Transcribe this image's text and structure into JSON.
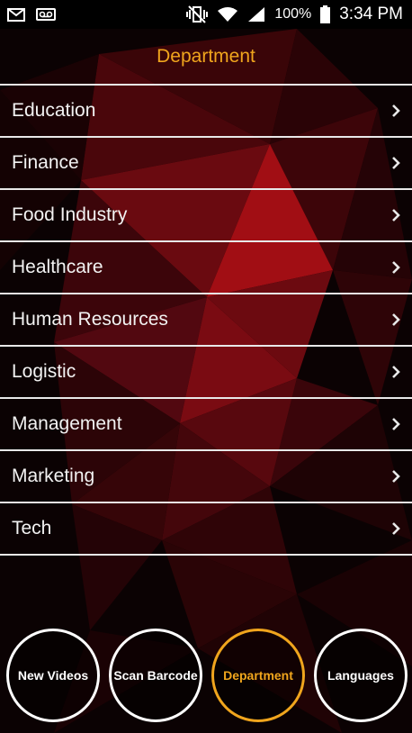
{
  "status_bar": {
    "battery": "100%",
    "time": "3:34 PM",
    "icons": [
      "mail-icon",
      "voicemail-icon",
      "vibrate-icon",
      "wifi-icon",
      "cell-signal-icon"
    ]
  },
  "header": {
    "title": "Department"
  },
  "departments": [
    {
      "label": "Education"
    },
    {
      "label": "Finance"
    },
    {
      "label": "Food Industry"
    },
    {
      "label": "Healthcare"
    },
    {
      "label": "Human Resources"
    },
    {
      "label": "Logistic"
    },
    {
      "label": "Management"
    },
    {
      "label": "Marketing"
    },
    {
      "label": "Tech"
    }
  ],
  "bottom_nav": {
    "items": [
      {
        "label": "New Videos",
        "active": false
      },
      {
        "label": "Scan Barcode",
        "active": false
      },
      {
        "label": "Department",
        "active": true
      },
      {
        "label": "Languages",
        "active": false
      }
    ]
  },
  "colors": {
    "accent": "#f0a51d",
    "divider": "#e8e8e8",
    "text": "#f2f2f2",
    "background": "#0b0203"
  }
}
